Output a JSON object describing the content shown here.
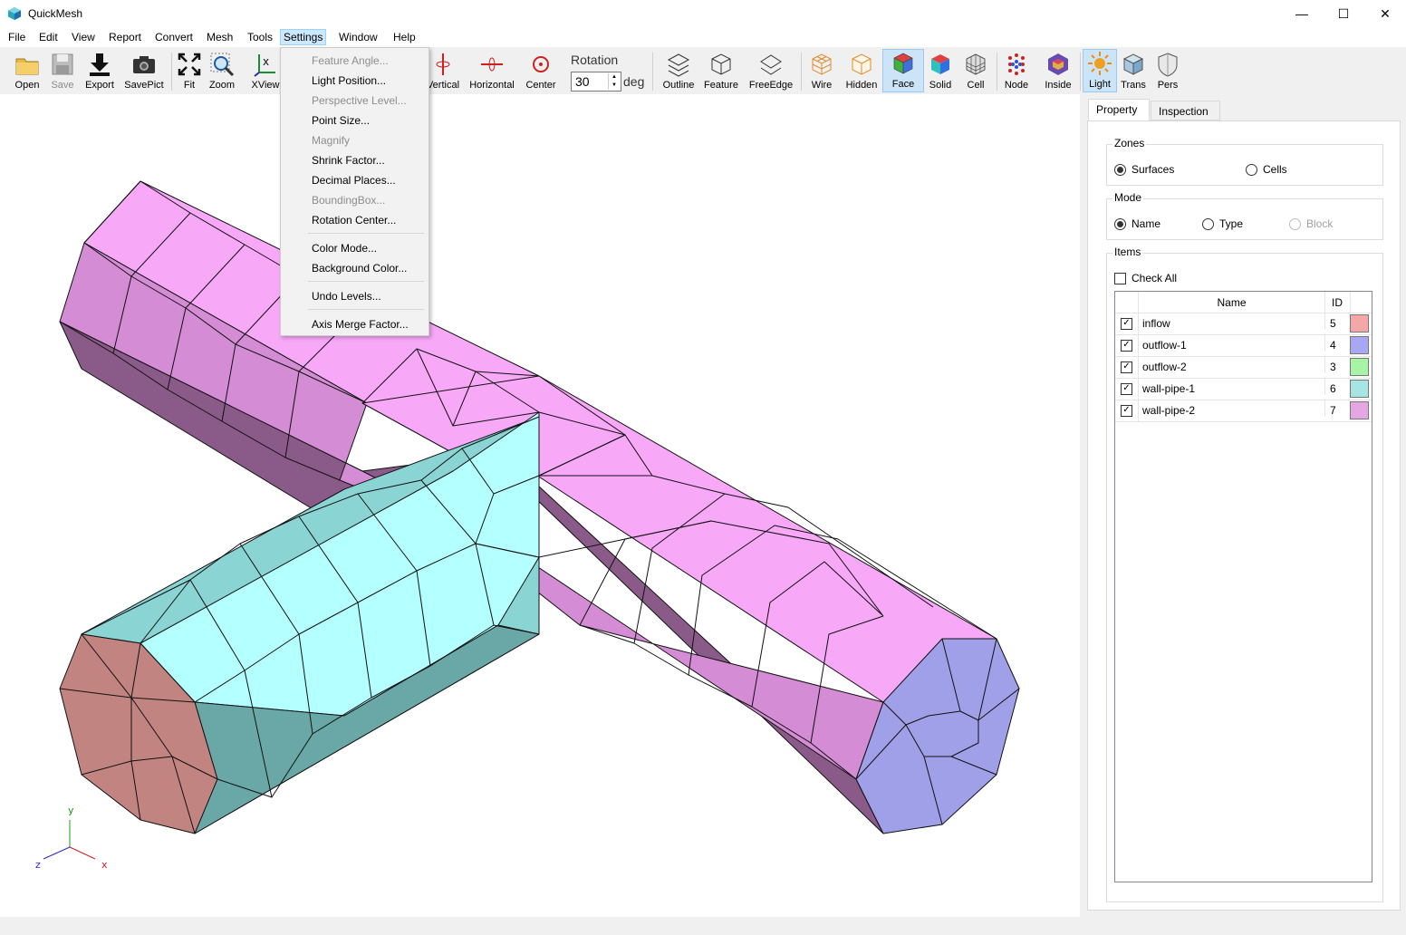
{
  "window": {
    "title": "QuickMesh",
    "minimize": "—",
    "maximize": "☐",
    "close": "✕"
  },
  "menu": [
    "File",
    "Edit",
    "View",
    "Report",
    "Convert",
    "Mesh",
    "Tools",
    "Settings",
    "Window",
    "Help"
  ],
  "active_menu": "Settings",
  "settings_menu": {
    "items": [
      {
        "label": "Feature Angle...",
        "enabled": false
      },
      {
        "label": "Light Position...",
        "enabled": true
      },
      {
        "label": "Perspective Level...",
        "enabled": false
      },
      {
        "label": "Point Size...",
        "enabled": true
      },
      {
        "label": "Magnify",
        "enabled": false
      },
      {
        "label": "Shrink Factor...",
        "enabled": true
      },
      {
        "label": "Decimal Places...",
        "enabled": true
      },
      {
        "label": "BoundingBox...",
        "enabled": false
      },
      {
        "label": "Rotation Center...",
        "enabled": true
      },
      {
        "label": "Color Mode...",
        "enabled": true
      },
      {
        "label": "Background Color...",
        "enabled": true
      },
      {
        "label": "Undo Levels...",
        "enabled": true
      },
      {
        "label": "Axis Merge Factor...",
        "enabled": true
      }
    ]
  },
  "toolbar": {
    "open": "Open",
    "save": "Save",
    "export": "Export",
    "savepict": "SavePict",
    "fit": "Fit",
    "zoom": "Zoom",
    "xview": "XView",
    "vertical": "Vertical",
    "horizontal": "Horizontal",
    "center": "Center",
    "rotation_label": "Rotation",
    "rotation_value": "30",
    "rotation_unit": "deg",
    "outline": "Outline",
    "feature": "Feature",
    "freeedge": "FreeEdge",
    "wire": "Wire",
    "hidden": "Hidden",
    "face": "Face",
    "solid": "Solid",
    "cell": "Cell",
    "node": "Node",
    "inside": "Inside",
    "light": "Light",
    "trans": "Trans",
    "pers": "Pers"
  },
  "axes": {
    "x": "x",
    "y": "y",
    "z": "z"
  },
  "panel": {
    "tabs": [
      "Property",
      "Inspection"
    ],
    "zones": {
      "title": "Zones",
      "options": [
        "Surfaces",
        "Cells"
      ],
      "selected": "Surfaces"
    },
    "mode": {
      "title": "Mode",
      "options": [
        "Name",
        "Type",
        "Block"
      ],
      "selected": "Name",
      "disabled": [
        "Block"
      ]
    },
    "items": {
      "title": "Items",
      "check_all": "Check All",
      "columns": [
        "Name",
        "ID"
      ],
      "rows": [
        {
          "name": "inflow",
          "id": "5",
          "color": "#f4a7a7",
          "checked": true
        },
        {
          "name": "outflow-1",
          "id": "4",
          "color": "#a7a7f4",
          "checked": true
        },
        {
          "name": "outflow-2",
          "id": "3",
          "color": "#a7f4a7",
          "checked": true
        },
        {
          "name": "wall-pipe-1",
          "id": "6",
          "color": "#a7e4e4",
          "checked": true
        },
        {
          "name": "wall-pipe-2",
          "id": "7",
          "color": "#e4a7e4",
          "checked": true
        }
      ]
    }
  }
}
